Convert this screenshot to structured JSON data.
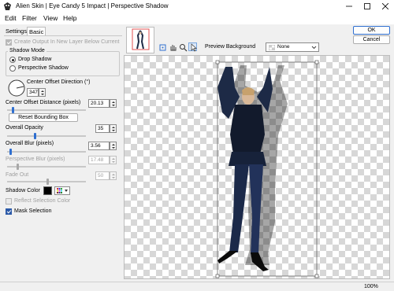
{
  "window": {
    "title": "Alien Skin | Eye Candy 5 Impact | Perspective Shadow"
  },
  "menu": [
    "Edit",
    "Filter",
    "View",
    "Help"
  ],
  "tabs": {
    "settings": "Settings",
    "basic": "Basic"
  },
  "basic": {
    "create_output_label": "Create Output In New Layer Below Current",
    "create_output_checked": true,
    "shadow_mode": {
      "title": "Shadow Mode",
      "options": [
        "Drop Shadow",
        "Perspective Shadow"
      ],
      "selected": "Drop Shadow"
    },
    "center_offset_direction": {
      "label": "Center Offset Direction (°)",
      "value": "347"
    },
    "center_offset_distance": {
      "label": "Center Offset Distance (pixels)",
      "value": "20.13"
    },
    "reset_bounding_box": "Reset Bounding Box",
    "overall_opacity": {
      "label": "Overall Opacity",
      "value": "35"
    },
    "overall_blur": {
      "label": "Overall Blur (pixels)",
      "value": "3.56"
    },
    "perspective_blur": {
      "label": "Perspective Blur (pixels)",
      "value": "17.48"
    },
    "fade_out": {
      "label": "Fade Out",
      "value": "50"
    },
    "shadow_color": {
      "label": "Shadow Color",
      "swatch": "#000000"
    },
    "reflect_selection_color": {
      "label": "Reflect Selection Color",
      "checked": false
    },
    "mask_selection": {
      "label": "Mask Selection",
      "checked": true
    }
  },
  "buttons": {
    "ok": "OK",
    "cancel": "Cancel"
  },
  "preview": {
    "background_label": "Preview Background",
    "background_value": "None",
    "zoom": "100%"
  },
  "colors": {
    "accent": "#2f6fd0",
    "slider_thumb": "#2f6fd0"
  }
}
